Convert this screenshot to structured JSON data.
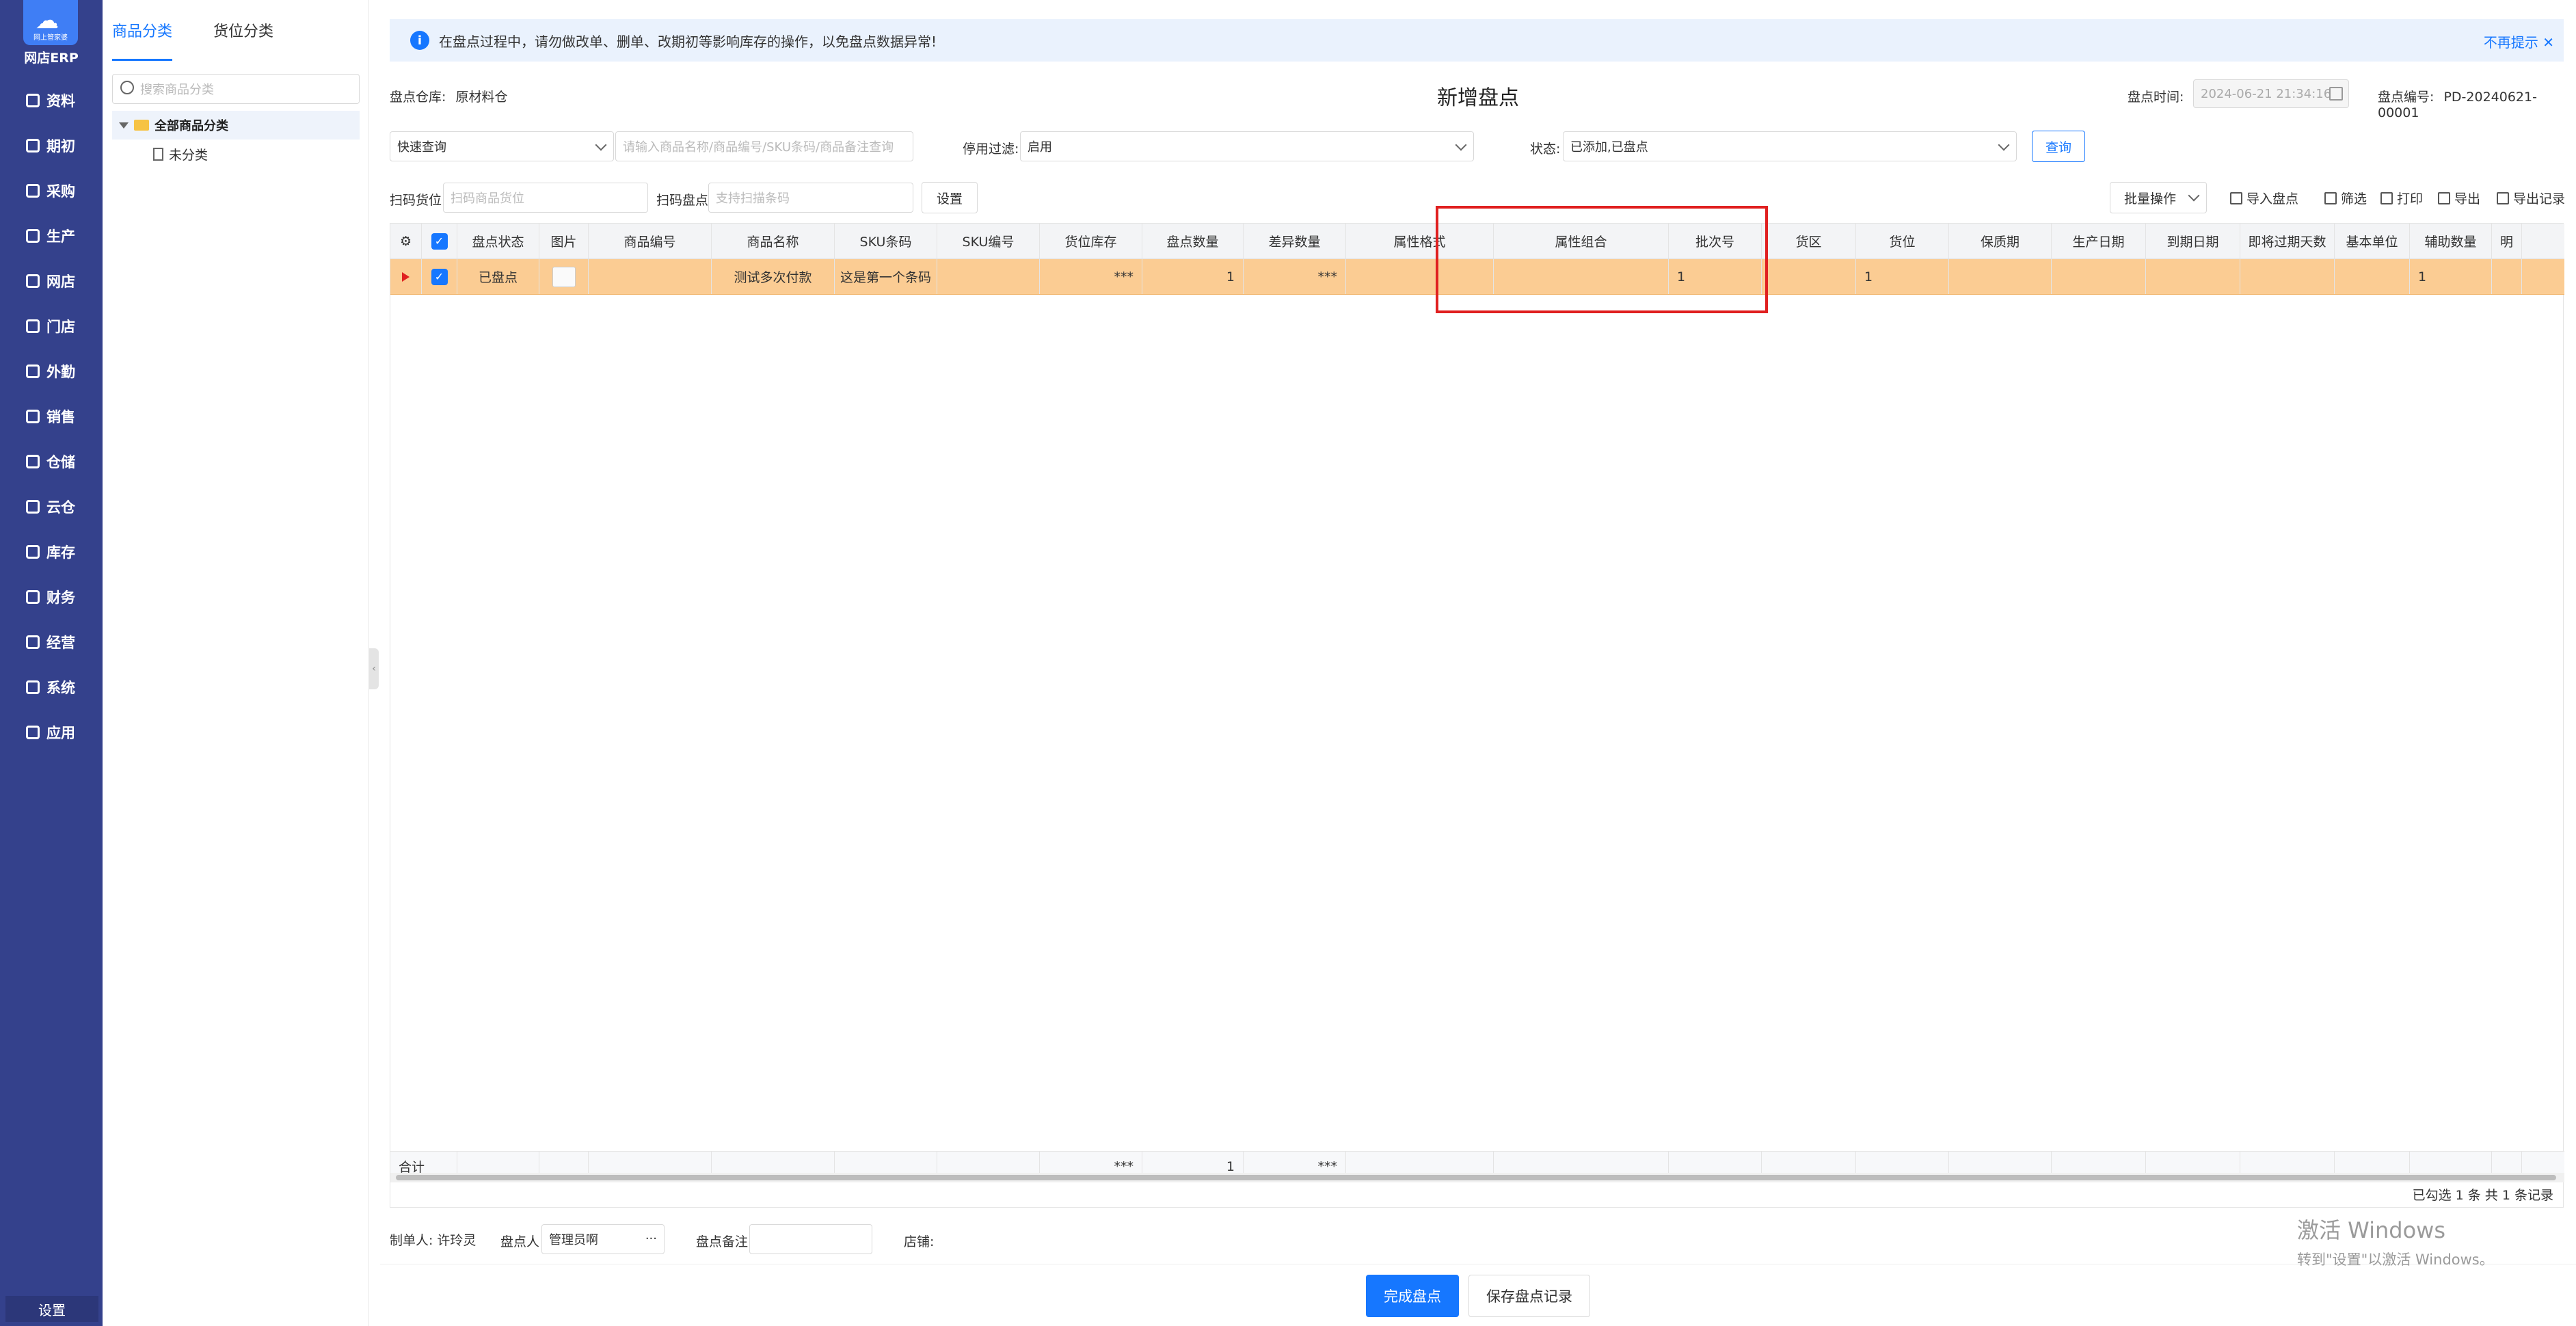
{
  "app": {
    "name": "网店ERP",
    "logo_sub": "网上管家婆"
  },
  "sidebar": {
    "items": [
      {
        "label": "资料",
        "icon": "data-icon"
      },
      {
        "label": "期初",
        "icon": "opening-icon"
      },
      {
        "label": "采购",
        "icon": "purchase-icon"
      },
      {
        "label": "生产",
        "icon": "production-icon"
      },
      {
        "label": "网店",
        "icon": "shop-icon"
      },
      {
        "label": "门店",
        "icon": "store-icon"
      },
      {
        "label": "外勤",
        "icon": "field-icon"
      },
      {
        "label": "销售",
        "icon": "sales-icon"
      },
      {
        "label": "仓储",
        "icon": "warehouse-icon"
      },
      {
        "label": "云仓",
        "icon": "cloud-warehouse-icon"
      },
      {
        "label": "库存",
        "icon": "inventory-icon"
      },
      {
        "label": "财务",
        "icon": "finance-icon"
      },
      {
        "label": "经营",
        "icon": "operation-icon"
      },
      {
        "label": "系统",
        "icon": "system-icon"
      },
      {
        "label": "应用",
        "icon": "apps-icon"
      }
    ],
    "settings_label": "设置"
  },
  "category_panel": {
    "tabs": [
      "商品分类",
      "货位分类"
    ],
    "active_tab": 0,
    "search_placeholder": "搜索商品分类",
    "tree_root": "全部商品分类",
    "tree_child": "未分类"
  },
  "notice": {
    "text": "在盘点过程中，请勿做改单、删单、改期初等影响库存的操作，以免盘点数据异常!",
    "dismiss": "不再提示"
  },
  "header": {
    "title": "新增盘点",
    "warehouse_label": "盘点仓库:",
    "warehouse_value": "原材料仓",
    "time_label": "盘点时间:",
    "time_value": "2024-06-21 21:34:16",
    "number_label": "盘点编号:",
    "number_value": "PD-20240621-00001"
  },
  "filters": {
    "quick_query": "快速查询",
    "search_placeholder": "请输入商品名称/商品编号/SKU条码/商品备注查询",
    "disable_filter_label": "停用过滤:",
    "disable_filter_value": "启用",
    "status_label": "状态:",
    "status_value": "已添加,已盘点",
    "query_button": "查询",
    "scan_location_label": "扫码货位",
    "scan_location_placeholder": "扫码商品货位",
    "scan_count_label": "扫码盘点",
    "scan_count_placeholder": "支持扫描条码",
    "settings_button": "设置"
  },
  "toolbar": {
    "batch": "批量操作",
    "import": "导入盘点",
    "filter": "筛选",
    "print": "打印",
    "export": "导出",
    "export_records": "导出记录"
  },
  "table": {
    "columns": [
      "盘点状态",
      "图片",
      "商品编号",
      "商品名称",
      "SKU条码",
      "SKU编号",
      "货位库存",
      "盘点数量",
      "差异数量",
      "属性格式",
      "属性组合",
      "批次号",
      "货区",
      "货位",
      "保质期",
      "生产日期",
      "到期日期",
      "即将过期天数",
      "基本单位",
      "辅助数量",
      "明"
    ],
    "rows": [
      {
        "status": "已盘点",
        "image": "",
        "product_code": "",
        "product_name": "测试多次付款",
        "sku_barcode": "这是第一个条码",
        "sku_code": "",
        "location_stock": "***",
        "count_qty": "1",
        "diff_qty": "***",
        "attr_format": "",
        "attr_combo": "",
        "batch_no": "1",
        "zone": "",
        "location": "1",
        "shelf_life": "",
        "produce_date": "",
        "expire_date": "",
        "expire_days": "",
        "base_unit": "",
        "aux_qty": "1",
        "extra": ""
      }
    ],
    "footer": {
      "label": "合计",
      "location_stock": "***",
      "count_qty": "1",
      "diff_qty": "***"
    },
    "status_text": "已勾选 1 条  共 1 条记录"
  },
  "bottom": {
    "creator_label": "制单人:",
    "creator_value": "许玲灵",
    "counter_label": "盘点人",
    "counter_value": "管理员啊",
    "counter_more": "···",
    "remark_label": "盘点备注",
    "store_label": "店铺:"
  },
  "actions": {
    "complete": "完成盘点",
    "save": "保存盘点记录"
  },
  "watermark": {
    "line1": "激活 Windows",
    "line2": "转到\"设置\"以激活 Windows。"
  },
  "colors": {
    "sidebar": "#34418c",
    "accent": "#1677ff",
    "selected_row": "#fbcc93",
    "highlight_box": "#e02020"
  }
}
